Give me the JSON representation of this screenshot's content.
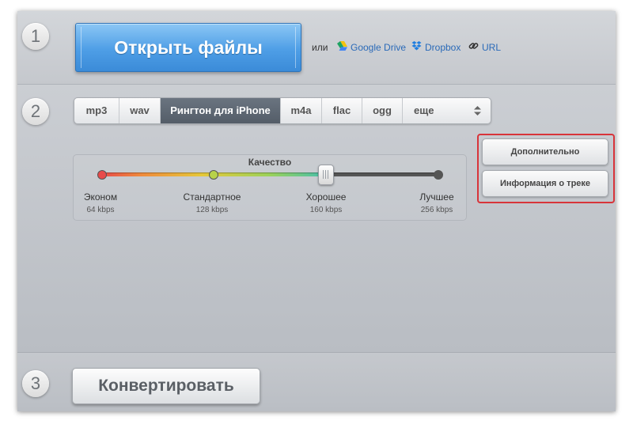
{
  "steps": {
    "one": "1",
    "two": "2",
    "three": "3"
  },
  "open": {
    "button_label": "Открыть файлы",
    "or_label": "или",
    "sources": [
      {
        "label": "Google Drive",
        "icon": "google-drive-icon"
      },
      {
        "label": "Dropbox",
        "icon": "dropbox-icon"
      },
      {
        "label": "URL",
        "icon": "link-icon"
      }
    ]
  },
  "formats": {
    "tabs": [
      {
        "label": "mp3"
      },
      {
        "label": "wav"
      },
      {
        "label": "Рингтон для iPhone",
        "active": true
      },
      {
        "label": "m4a"
      },
      {
        "label": "flac"
      },
      {
        "label": "ogg"
      },
      {
        "label": "еще"
      }
    ],
    "more_arrow_icon": "up-down-arrows-icon"
  },
  "quality": {
    "title": "Качество",
    "selected_index": 2,
    "levels": [
      {
        "name": "Эконом",
        "bitrate": "64 kbps"
      },
      {
        "name": "Стандартное",
        "bitrate": "128 kbps"
      },
      {
        "name": "Хорошее",
        "bitrate": "160 kbps"
      },
      {
        "name": "Лучшее",
        "bitrate": "256 kbps"
      }
    ]
  },
  "side": {
    "advanced_label": "Дополнительно",
    "track_info_label": "Информация о треке",
    "highlight_color": "#d8343a"
  },
  "convert": {
    "button_label": "Конвертировать"
  },
  "colors": {
    "primary_button": "#4e9ee6",
    "active_tab": "#5c6571"
  }
}
